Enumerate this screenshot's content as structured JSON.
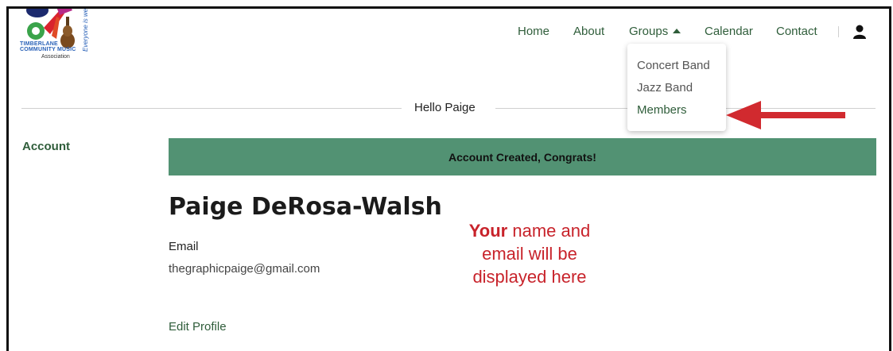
{
  "logo": {
    "line1": "TIMBERLANE",
    "line2": "COMMUNITY MUSIC",
    "line3": "Association",
    "tagline": "Everyone is welc"
  },
  "nav": {
    "home": "Home",
    "about": "About",
    "groups": "Groups",
    "calendar": "Calendar",
    "contact": "Contact",
    "user_icon": "user-icon"
  },
  "dropdown": {
    "items": [
      "Concert Band",
      "Jazz Band",
      "Members"
    ]
  },
  "hello_text": "Hello Paige",
  "sidebar": {
    "account": "Account"
  },
  "banner": {
    "text": "Account Created, Congrats!"
  },
  "profile": {
    "name": "Paige DeRosa-Walsh",
    "email_label": "Email",
    "email_value": "thegraphicpaige@gmail.com",
    "edit_link": "Edit Profile"
  },
  "annotation": {
    "bold_word": "Your",
    "rest_line1": " name and",
    "line2": "email will be",
    "line3": "displayed here"
  },
  "colors": {
    "accent_green": "#529273",
    "link_green": "#2f5d3a",
    "annotation_red": "#c8232b",
    "arrow_red": "#d12a2f"
  }
}
